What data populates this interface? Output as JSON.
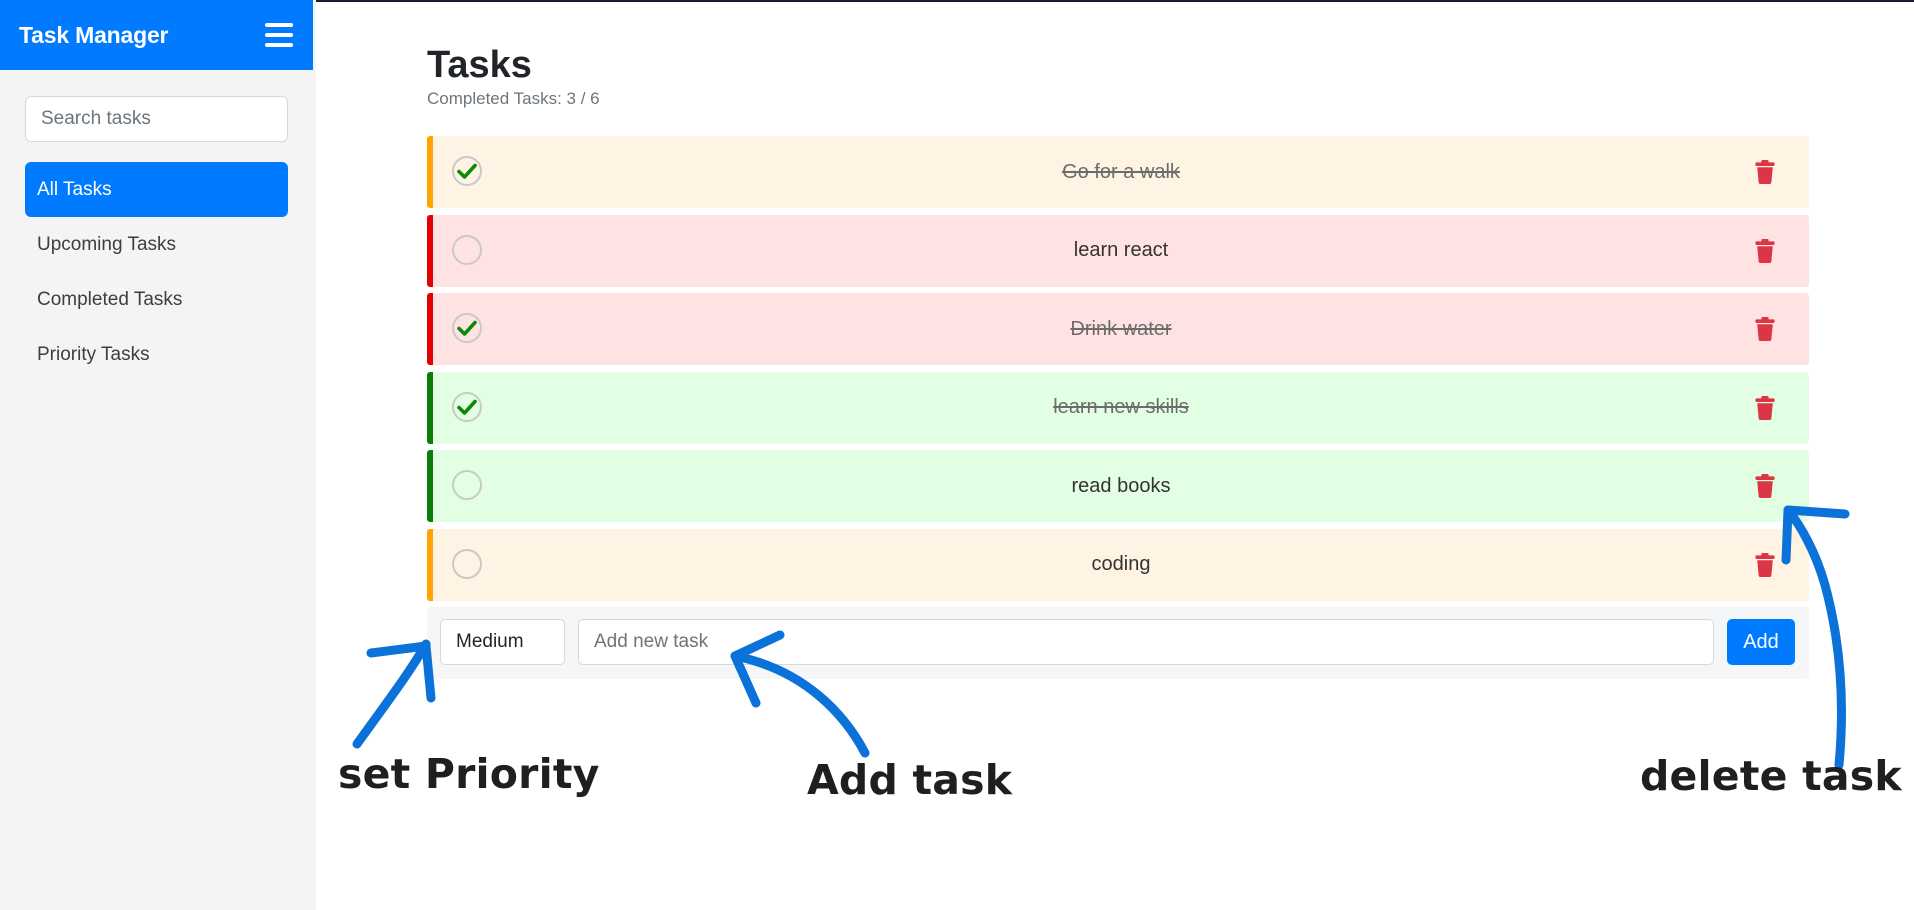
{
  "sidebar": {
    "title": "Task Manager",
    "search_placeholder": "Search tasks",
    "items": [
      {
        "label": "All Tasks",
        "active": true
      },
      {
        "label": "Upcoming Tasks",
        "active": false
      },
      {
        "label": "Completed Tasks",
        "active": false
      },
      {
        "label": "Priority Tasks",
        "active": false
      }
    ]
  },
  "main": {
    "title": "Tasks",
    "completed_summary": "Completed Tasks: 3 / 6",
    "tasks": [
      {
        "text": "Go for a walk",
        "priority": "medium",
        "done": true
      },
      {
        "text": "learn react",
        "priority": "high",
        "done": false
      },
      {
        "text": "Drink water",
        "priority": "high",
        "done": true
      },
      {
        "text": "learn new skills",
        "priority": "low",
        "done": true
      },
      {
        "text": "read books",
        "priority": "low",
        "done": false
      },
      {
        "text": "coding",
        "priority": "medium",
        "done": false
      }
    ],
    "add_bar": {
      "priority_value": "Medium",
      "new_task_placeholder": "Add new task",
      "add_label": "Add"
    }
  },
  "annotations": {
    "set_priority": "set Priority",
    "add_task": "Add task",
    "delete_task": "delete task"
  },
  "colors": {
    "accent": "#007bff",
    "medium_bg": "#fff3e3",
    "medium_border": "#ffa500",
    "high_bg": "#ffe3e3",
    "high_border": "#e60000",
    "low_bg": "#e3ffe3",
    "low_border": "#0a7d0a",
    "trash": "#dc3545",
    "check": "#0a8a0a",
    "annotation_arrow": "#0a72d8"
  },
  "icons": {
    "menu": "hamburger-icon",
    "complete": "checkmark-icon",
    "delete": "trash-icon"
  }
}
